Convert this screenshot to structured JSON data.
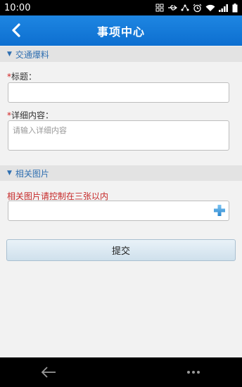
{
  "status_bar": {
    "time": "10:00",
    "icons": [
      "screenshot-icon",
      "usb-icon",
      "share-icon",
      "alarm-icon",
      "wifi-icon",
      "signal-icon",
      "battery-icon"
    ]
  },
  "header": {
    "title": "事项中心",
    "back_icon": "back-chevron-icon"
  },
  "sections": {
    "traffic": {
      "title": "交通爆料"
    },
    "images": {
      "title": "相关图片"
    }
  },
  "form": {
    "title_label": "标题：",
    "title_value": "",
    "detail_label": "详细内容：",
    "detail_placeholder": "请输入详细内容",
    "required_mark": "*",
    "image_hint": "相关图片请控制在三张以内",
    "submit_label": "提交"
  },
  "colors": {
    "header_bg": "#1479d8",
    "section_text": "#2f6fb1",
    "required": "#d02020",
    "hint": "#c62828",
    "plus": "#3a9ad9"
  }
}
